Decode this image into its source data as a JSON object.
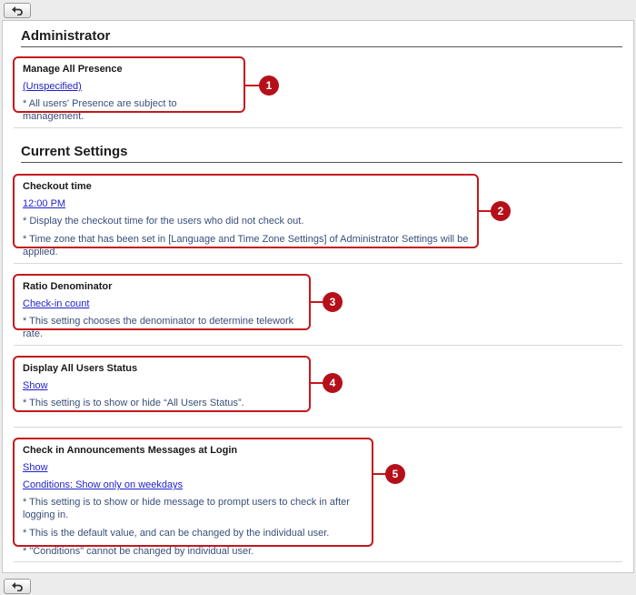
{
  "sections": {
    "administrator": "Administrator",
    "current_settings": "Current Settings"
  },
  "items": [
    {
      "label": "Manage All Presence",
      "links": [
        "(Unspecified)"
      ],
      "notes": [
        "* All users' Presence are subject to management."
      ],
      "badge": "1"
    },
    {
      "label": "Checkout time",
      "links": [
        "12:00 PM"
      ],
      "notes": [
        "* Display the checkout time for the users who did not check out.",
        "* Time zone that has been set in [Language and Time Zone Settings] of Administrator Settings will be applied."
      ],
      "badge": "2"
    },
    {
      "label": "Ratio Denominator",
      "links": [
        "Check-in count"
      ],
      "notes": [
        "* This setting chooses the denominator to determine telework rate."
      ],
      "badge": "3"
    },
    {
      "label": "Display All Users Status",
      "links": [
        "Show"
      ],
      "notes": [
        "* This setting is to show or hide “All Users Status”."
      ],
      "badge": "4"
    },
    {
      "label": "Check in Announcements Messages at Login",
      "links": [
        "Show",
        "Conditions: Show only on weekdays"
      ],
      "notes": [
        "* This setting is to show or hide message to prompt users to check in after logging in.",
        "* This is the default value, and can be changed by the individual user.",
        "* \"Conditions\" cannot be changed by individual user."
      ],
      "badge": "5"
    }
  ],
  "icons": {
    "back": "back-arrow-icon"
  },
  "colors": {
    "accent": "#c3191d",
    "link": "#1f1fcc",
    "note": "#3a4f7a"
  }
}
